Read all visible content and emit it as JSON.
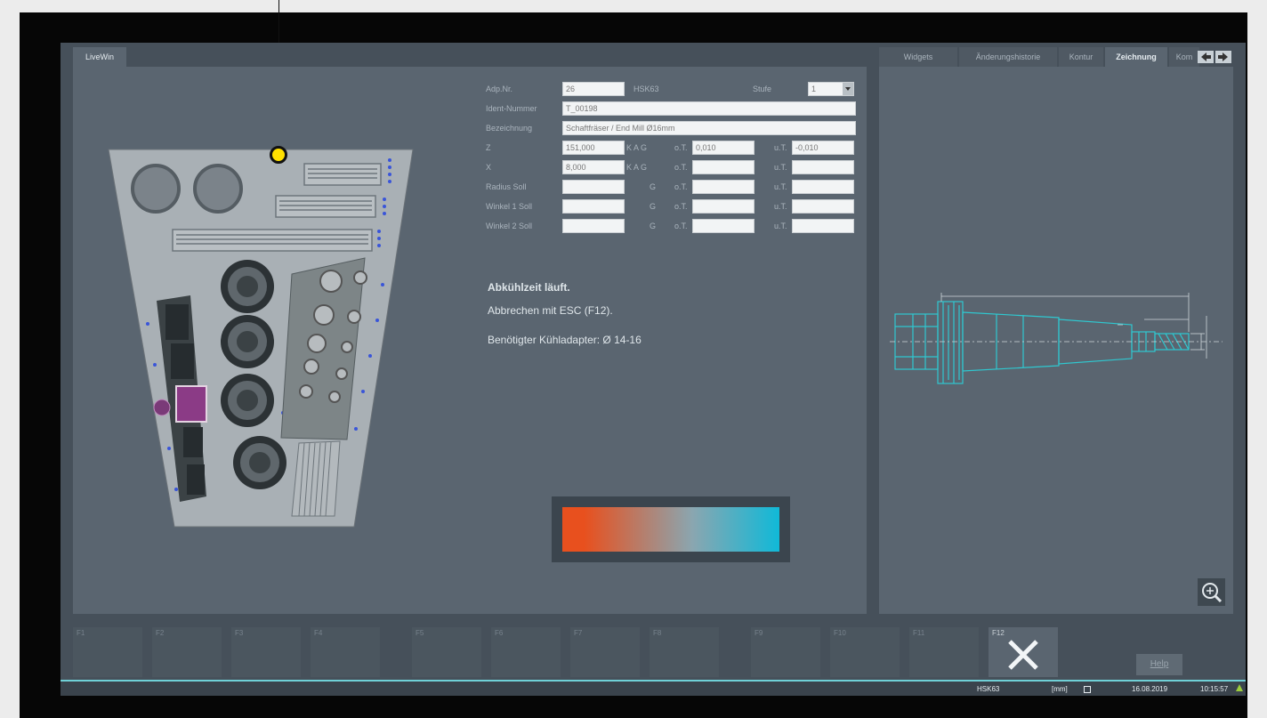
{
  "left_tab": "LiveWin",
  "right_tabs": [
    "Widgets",
    "Änderungshistorie",
    "Kontur",
    "Zeichnung",
    "Kom"
  ],
  "form": {
    "adp_label": "Adp.Nr.",
    "adp_value": "26",
    "adp_code": "HSK63",
    "stufe_label": "Stufe",
    "stufe_value": "1",
    "ident_label": "Ident-Nummer",
    "ident_value": "T_00198",
    "bez_label": "Bezeichnung",
    "bez_value": "Schaftfräser / End Mill Ø16mm",
    "rows": [
      {
        "label": "Z",
        "value": "151,000",
        "mode": "K A G",
        "ot_label": "o.T.",
        "ot_value": "0,010",
        "ut_label": "u.T.",
        "ut_value": "-0,010"
      },
      {
        "label": "X",
        "value": "8,000",
        "mode": "K A G",
        "ot_label": "o.T.",
        "ot_value": "",
        "ut_label": "u.T.",
        "ut_value": ""
      },
      {
        "label": "Radius Soll",
        "value": "",
        "mode": "G",
        "ot_label": "o.T.",
        "ot_value": "",
        "ut_label": "u.T.",
        "ut_value": ""
      },
      {
        "label": "Winkel 1 Soll",
        "value": "",
        "mode": "G",
        "ot_label": "o.T.",
        "ot_value": "",
        "ut_label": "u.T.",
        "ut_value": ""
      },
      {
        "label": "Winkel 2 Soll",
        "value": "",
        "mode": "G",
        "ot_label": "o.T.",
        "ot_value": "",
        "ut_label": "u.T.",
        "ut_value": ""
      }
    ]
  },
  "message": {
    "title": "Abkühlzeit läuft.",
    "line1": "Abbrechen mit ESC (F12).",
    "line2": "Benötigter Kühladapter: Ø 14-16"
  },
  "gradient": {
    "start": "#e8501e",
    "end": "#10b9d8"
  },
  "fkeys": [
    "F1",
    "F2",
    "F3",
    "F4",
    "F5",
    "F6",
    "F7",
    "F8",
    "F9",
    "F10",
    "F11",
    "F12"
  ],
  "help_label": "Help",
  "status": {
    "adapter": "HSK63",
    "unit": "[mm]",
    "date": "16.08.2019",
    "time": "10:15:57"
  },
  "colors": {
    "accent_cyan": "#6fd0d6",
    "marker_yellow": "#ffe000",
    "tool_drawing": "#2fc8d0",
    "slot_purple": "#8b3b86"
  },
  "icons": [
    "zoom-icon",
    "close-icon",
    "arrow-left-icon",
    "arrow-right-icon",
    "dropdown-arrow-icon"
  ]
}
